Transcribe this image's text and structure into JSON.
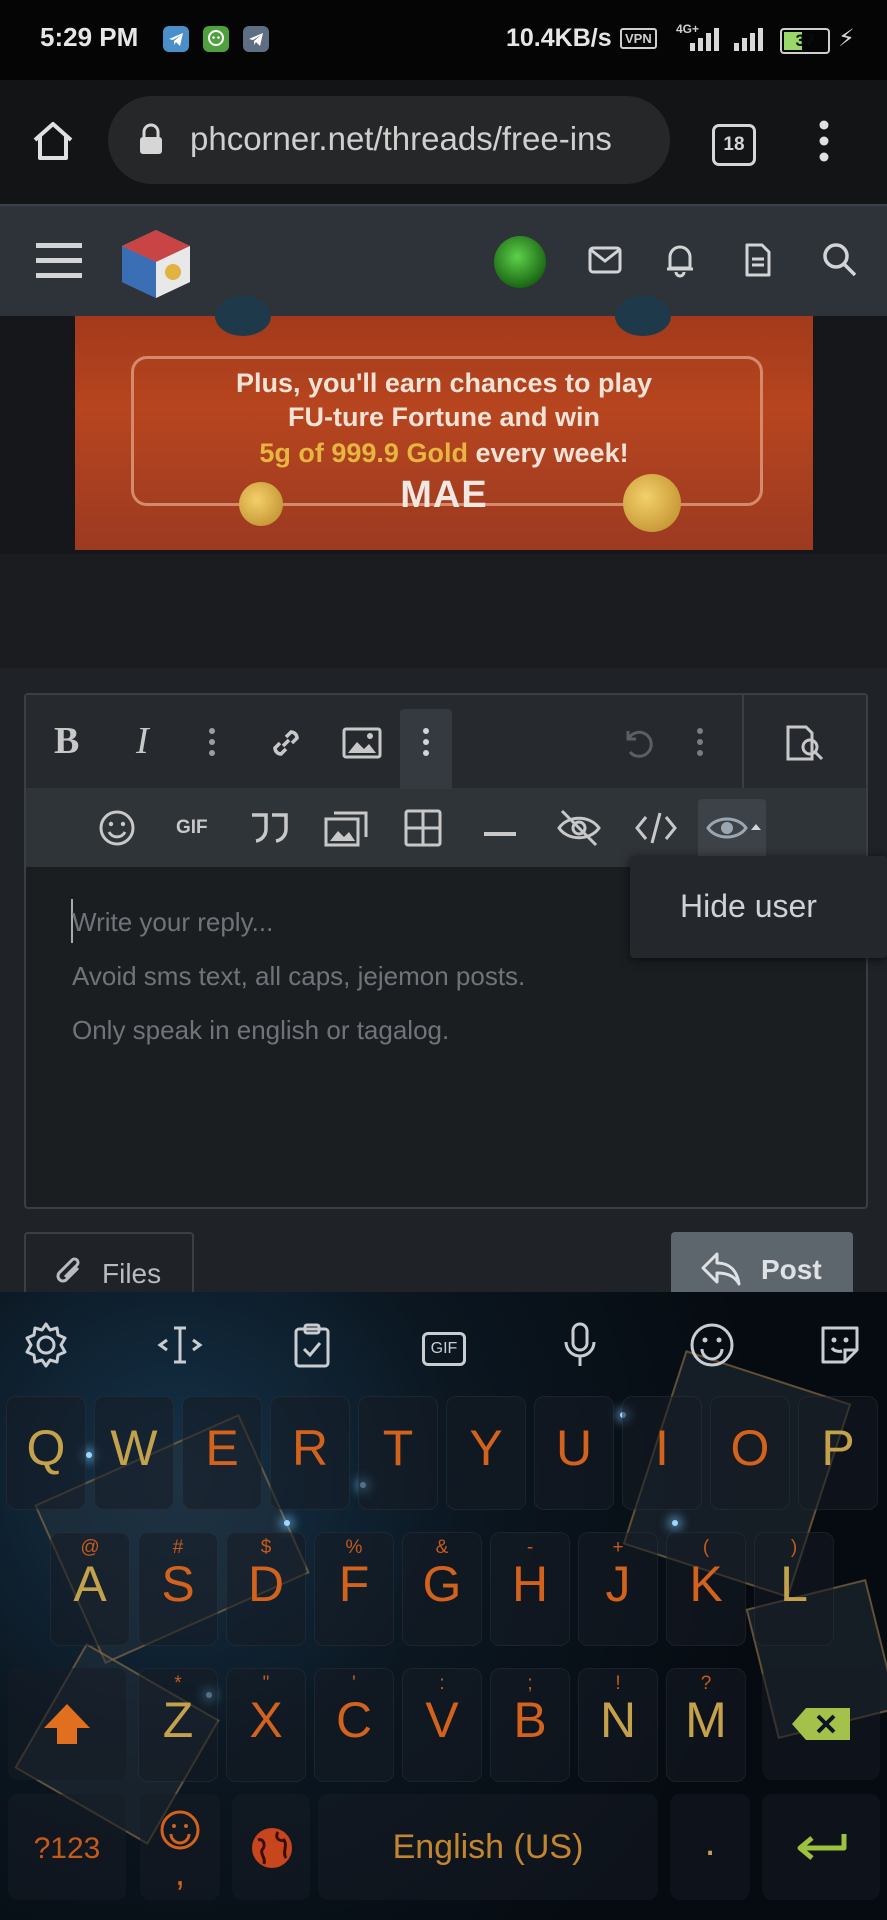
{
  "status_bar": {
    "time": "5:29 PM",
    "net_speed": "10.4KB/s",
    "vpn": "VPN",
    "network": "4G+",
    "battery": "37"
  },
  "browser": {
    "url": "phcorner.net/threads/free-ins",
    "tab_count": "18"
  },
  "ad": {
    "line1": "Plus, you'll earn chances to play",
    "line2": "FU-ture Fortune and win",
    "line3_gold": "5g of 999.9 Gold",
    "line3_rest": "every week!",
    "brand": "MAE"
  },
  "editor": {
    "toolbar1": [
      "bold",
      "italic",
      "more",
      "link",
      "image",
      "more",
      "undo",
      "more",
      "preview"
    ],
    "toolbar2": [
      "smilies",
      "GIF",
      "quote",
      "media",
      "table",
      "horizontal-line",
      "hide",
      "code",
      "hide-user"
    ],
    "gif_label": "GIF",
    "placeholder_line1": "Write your reply...",
    "placeholder_line2": "Avoid sms text, all caps, jejemon posts.",
    "placeholder_line3": "Only speak in english or tagalog.",
    "popup_item": "Hide user"
  },
  "actions": {
    "files_label": "Files",
    "post_label": "Post"
  },
  "keyboard": {
    "gif": "GIF",
    "row1": [
      {
        "k": "Q"
      },
      {
        "k": "W"
      },
      {
        "k": "E"
      },
      {
        "k": "R"
      },
      {
        "k": "T"
      },
      {
        "k": "Y"
      },
      {
        "k": "U"
      },
      {
        "k": "I"
      },
      {
        "k": "O"
      },
      {
        "k": "P"
      }
    ],
    "row2": [
      {
        "k": "A",
        "s": "@"
      },
      {
        "k": "S",
        "s": "#"
      },
      {
        "k": "D",
        "s": "$"
      },
      {
        "k": "F",
        "s": "%"
      },
      {
        "k": "G",
        "s": "&"
      },
      {
        "k": "H",
        "s": "-"
      },
      {
        "k": "J",
        "s": "+"
      },
      {
        "k": "K",
        "s": "("
      },
      {
        "k": "L",
        "s": ")"
      }
    ],
    "row3": [
      {
        "k": "Z",
        "s": "*"
      },
      {
        "k": "X",
        "s": "\""
      },
      {
        "k": "C",
        "s": "'"
      },
      {
        "k": "V",
        "s": ":"
      },
      {
        "k": "B",
        "s": ";"
      },
      {
        "k": "N",
        "s": "!"
      },
      {
        "k": "M",
        "s": "?"
      }
    ],
    "sym_key": "?123",
    "space_label": "English (US)",
    "period": ".",
    "comma": ","
  }
}
